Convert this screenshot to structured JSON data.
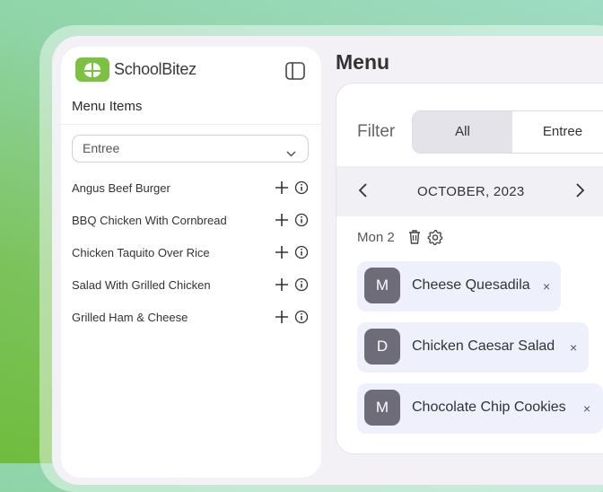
{
  "app": {
    "name": "SchoolBitez"
  },
  "sidebar": {
    "title": "Menu Items",
    "category_select": {
      "value": "Entree"
    },
    "items": [
      {
        "label": "Angus Beef Burger"
      },
      {
        "label": "BBQ Chicken With Cornbread"
      },
      {
        "label": "Chicken Taquito Over Rice"
      },
      {
        "label": "Salad With Grilled Chicken"
      },
      {
        "label": "Grilled Ham & Cheese"
      }
    ]
  },
  "main": {
    "title": "Menu",
    "filter": {
      "label": "Filter",
      "options": [
        {
          "label": "All"
        },
        {
          "label": "Entree"
        }
      ],
      "selected": "All"
    },
    "calendar": {
      "month": "OCTOBER, 2023"
    },
    "day": {
      "label": "Mon 2",
      "items": [
        {
          "initial": "M",
          "name": "Cheese Quesadila",
          "remove": "×"
        },
        {
          "initial": "D",
          "name": "Chicken Caesar Salad",
          "remove": "×"
        },
        {
          "initial": "M",
          "name": "Chocolate Chip Cookies",
          "remove": "×"
        }
      ]
    }
  },
  "colors": {
    "brand": "#7cc142",
    "chip": "#eef0fb",
    "avatar": "#6e6c78",
    "segment_active": "#e4e3ea"
  },
  "icons": [
    "sidebar-toggle-icon",
    "chevron-down-icon",
    "plus-icon",
    "info-icon",
    "chevron-left-icon",
    "chevron-right-icon",
    "trash-icon",
    "gear-icon",
    "close-icon"
  ]
}
